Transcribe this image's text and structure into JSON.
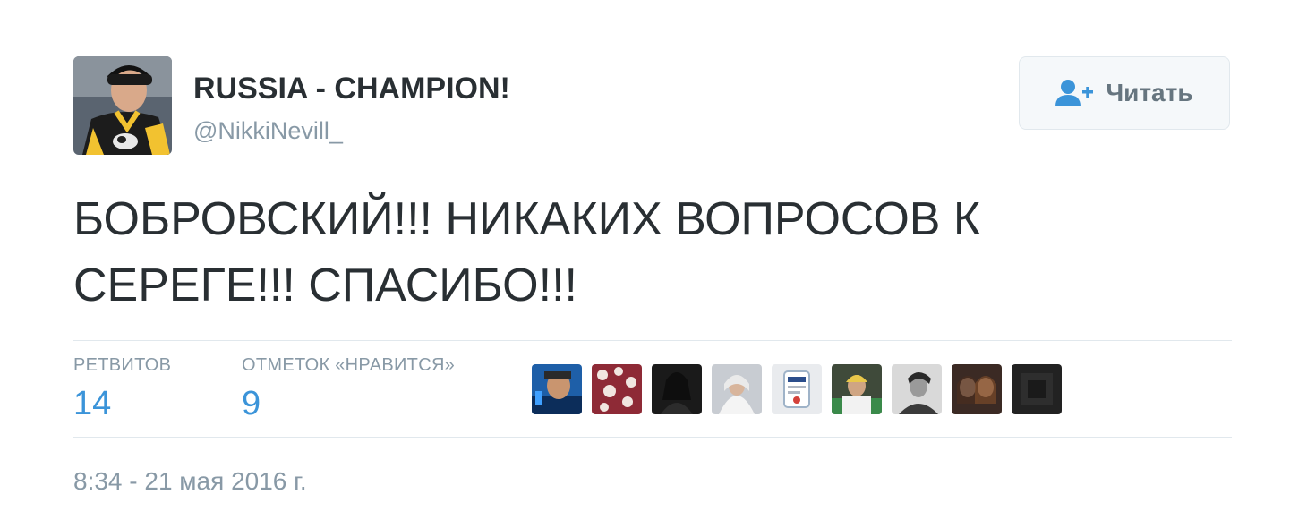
{
  "tweet": {
    "author": {
      "display_name": "RUSSIA - CHAMPION!",
      "username": "@NikkiNevill_"
    },
    "follow_button": {
      "label": "Читать",
      "icon": "follow-user-icon"
    },
    "text_line1": "БОБРОВСКИЙ!!! НИКАКИХ ВОПРОСОВ К",
    "text_line2": "СЕРЕГЕ!!! СПАСИБО!!!",
    "stats": {
      "retweets_label": "РЕТВИТОВ",
      "retweets_count": "14",
      "likes_label": "ОТМЕТОК «НРАВИТСЯ»",
      "likes_count": "9"
    },
    "timestamp": "8:34 - 21 мая 2016 г."
  },
  "colors": {
    "accent": "#3b94d9",
    "muted": "#8899a6",
    "text": "#292f33",
    "border": "#e1e8ed",
    "button_bg": "#f5f8fa"
  },
  "liker_avatars": [
    {
      "icon": "user-avatar-1"
    },
    {
      "icon": "user-avatar-2"
    },
    {
      "icon": "user-avatar-3"
    },
    {
      "icon": "user-avatar-4"
    },
    {
      "icon": "user-avatar-5"
    },
    {
      "icon": "user-avatar-6"
    },
    {
      "icon": "user-avatar-7"
    },
    {
      "icon": "user-avatar-8"
    },
    {
      "icon": "user-avatar-9"
    }
  ]
}
